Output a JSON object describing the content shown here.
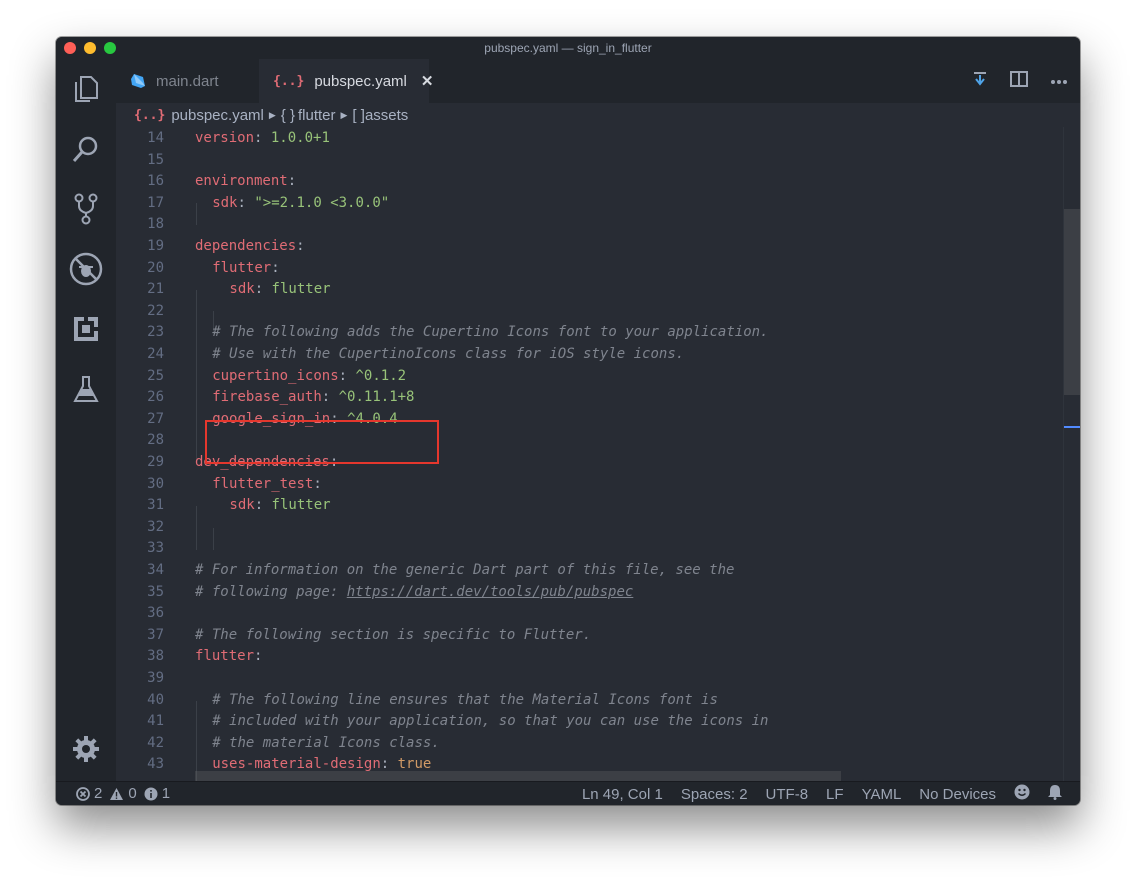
{
  "window": {
    "title": "pubspec.yaml — sign_in_flutter"
  },
  "tabs": [
    {
      "label": "main.dart",
      "icon": "dart-icon",
      "active": false
    },
    {
      "label": "pubspec.yaml",
      "icon": "yaml-braces-icon",
      "active": true,
      "close": "✕"
    }
  ],
  "breadcrumb": {
    "file": "pubspec.yaml",
    "items": [
      {
        "icon": "{ }",
        "label": "flutter"
      },
      {
        "icon": "[ ]",
        "label": "assets"
      }
    ]
  },
  "code": {
    "lines": [
      {
        "n": "14",
        "key": "version",
        "val": "1.0.0+1",
        "indent": 0
      },
      {
        "n": "15"
      },
      {
        "n": "16",
        "key": "environment",
        "indent": 0
      },
      {
        "n": "17",
        "key": "sdk",
        "val": "\">=2.1.0 <3.0.0\"",
        "indent": 1
      },
      {
        "n": "18"
      },
      {
        "n": "19",
        "key": "dependencies",
        "indent": 0
      },
      {
        "n": "20",
        "key": "flutter",
        "indent": 1
      },
      {
        "n": "21",
        "key": "sdk",
        "val": "flutter",
        "indent": 2
      },
      {
        "n": "22"
      },
      {
        "n": "23",
        "comment": "# The following adds the Cupertino Icons font to your application.",
        "indent": 1
      },
      {
        "n": "24",
        "comment": "# Use with the CupertinoIcons class for iOS style icons.",
        "indent": 1
      },
      {
        "n": "25",
        "key": "cupertino_icons",
        "val": "^0.1.2",
        "indent": 1
      },
      {
        "n": "26",
        "key": "firebase_auth",
        "val": "^0.11.1+8",
        "indent": 1
      },
      {
        "n": "27",
        "key": "google_sign_in",
        "val": "^4.0.4",
        "indent": 1
      },
      {
        "n": "28"
      },
      {
        "n": "29",
        "key": "dev_dependencies",
        "indent": 0
      },
      {
        "n": "30",
        "key": "flutter_test",
        "indent": 1
      },
      {
        "n": "31",
        "key": "sdk",
        "val": "flutter",
        "indent": 2
      },
      {
        "n": "32"
      },
      {
        "n": "33"
      },
      {
        "n": "34",
        "comment": "# For information on the generic Dart part of this file, see the",
        "indent": 0
      },
      {
        "n": "35",
        "comment": "# following page: ",
        "link": "https://dart.dev/tools/pub/pubspec",
        "indent": 0
      },
      {
        "n": "36"
      },
      {
        "n": "37",
        "comment": "# The following section is specific to Flutter.",
        "indent": 0
      },
      {
        "n": "38",
        "key": "flutter",
        "indent": 0
      },
      {
        "n": "39"
      },
      {
        "n": "40",
        "comment": "# The following line ensures that the Material Icons font is",
        "indent": 1
      },
      {
        "n": "41",
        "comment": "# included with your application, so that you can use the icons in",
        "indent": 1
      },
      {
        "n": "42",
        "comment": "# the material Icons class.",
        "indent": 1
      },
      {
        "n": "43",
        "key": "uses-material-design",
        "bool": "true",
        "indent": 1
      }
    ]
  },
  "status": {
    "errors": "2",
    "warnings": "0",
    "infos": "1",
    "position": "Ln 49, Col 1",
    "spaces": "Spaces: 2",
    "encoding": "UTF-8",
    "eol": "LF",
    "language": "YAML",
    "devices": "No Devices"
  },
  "colors": {
    "key": "#e06c75",
    "string": "#98c379",
    "comment": "#7f848e",
    "highlight_box": "#e5372d"
  }
}
